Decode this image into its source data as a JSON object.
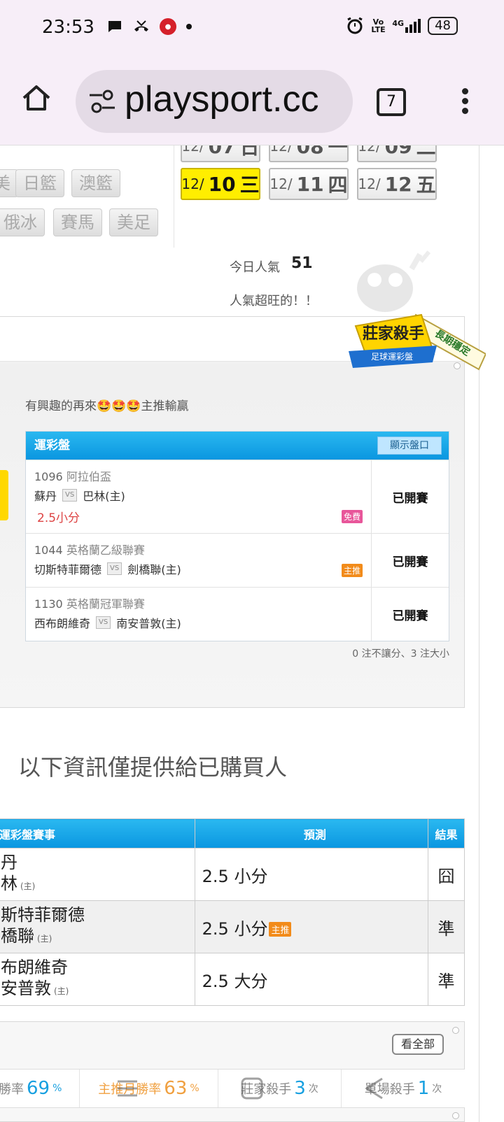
{
  "status_bar": {
    "time": "23:53",
    "left_icons": [
      "chat-bubble-icon",
      "missed-call-icon",
      "app-badge-icon",
      "dot-icon"
    ],
    "right_icons": [
      "alarm-icon",
      "volte-icon",
      "signal-4g-icon"
    ],
    "volte": "Vo LTE",
    "network": "4G",
    "battery": "48"
  },
  "browser": {
    "url": "playsport.cc",
    "tab_count": "7",
    "icons": [
      "home-icon",
      "tune-icon",
      "tabs-icon",
      "more-vert-icon"
    ]
  },
  "dates": [
    {
      "prefix": "12/",
      "day": "07",
      "weekday": "日",
      "active": false
    },
    {
      "prefix": "12/",
      "day": "08",
      "weekday": "一",
      "active": false
    },
    {
      "prefix": "12/",
      "day": "09",
      "weekday": "二",
      "active": false
    },
    {
      "prefix": "12/",
      "day": "10",
      "weekday": "三",
      "active": true
    },
    {
      "prefix": "12/",
      "day": "11",
      "weekday": "四",
      "active": false
    },
    {
      "prefix": "12/",
      "day": "12",
      "weekday": "五",
      "active": false
    }
  ],
  "sports": [
    "美",
    "日籃",
    "澳籃",
    "俄冰",
    "賽馬",
    "美足"
  ],
  "popularity": {
    "label": "今日人氣",
    "value": "51",
    "message": "人氣超旺的！！"
  },
  "badge": {
    "title": "莊家殺手",
    "subtitle": "足球運彩盤",
    "ribbon": "長期穩定"
  },
  "card": {
    "intro": "有興趣的再來🤩🤩🤩主推輸贏",
    "table_title": "運彩盤",
    "show_button": "顯示盤口",
    "games": [
      {
        "id": "1096",
        "league": "阿拉伯盃",
        "away": "蘇丹",
        "vs": "VS",
        "home": "巴林(主)",
        "pick": "2.5小分",
        "tag": "免費",
        "status": "已開賽"
      },
      {
        "id": "1044",
        "league": "英格蘭乙級聯賽",
        "away": "切斯特菲爾德",
        "vs": "VS",
        "home": "劍橋聯(主)",
        "pick": "",
        "tag": "主推",
        "status": "已開賽"
      },
      {
        "id": "1130",
        "league": "英格蘭冠軍聯賽",
        "away": "西布朗維奇",
        "vs": "VS",
        "home": "南安普敦(主)",
        "pick": "",
        "tag": "",
        "status": "已開賽"
      }
    ],
    "summary": "0 注不讓分、3 注大小"
  },
  "buyers": {
    "title": "以下資訊僅提供給已購買人",
    "headers": [
      "運彩盤賽事",
      "預測",
      "結果"
    ],
    "home_mark": "(主)",
    "main_tag": "主推",
    "rows": [
      {
        "away": "丹",
        "home": "林",
        "prediction": "2.5 小分",
        "main": false,
        "result": "囧"
      },
      {
        "away": "斯特菲爾德",
        "home": "橋聯",
        "prediction": "2.5 小分",
        "main": true,
        "result": "準"
      },
      {
        "away": "布朗維奇",
        "home": "安普敦",
        "prediction": "2.5 大分",
        "main": false,
        "result": "準"
      }
    ]
  },
  "stats": {
    "see_all": "看全部",
    "items": [
      {
        "label": "勝率",
        "value": "69",
        "unit": "%",
        "color": "#18a0e0"
      },
      {
        "label": "主推月勝率",
        "value": "63",
        "unit": "%",
        "color": "#f0a040"
      },
      {
        "label": "莊家殺手",
        "value": "3",
        "unit": "次",
        "color": "#18a0e0"
      },
      {
        "label": "單場殺手",
        "value": "1",
        "unit": "次",
        "color": "#18a0e0"
      }
    ]
  },
  "nav_icons": [
    "recents-icon",
    "home-square-icon",
    "back-icon"
  ]
}
